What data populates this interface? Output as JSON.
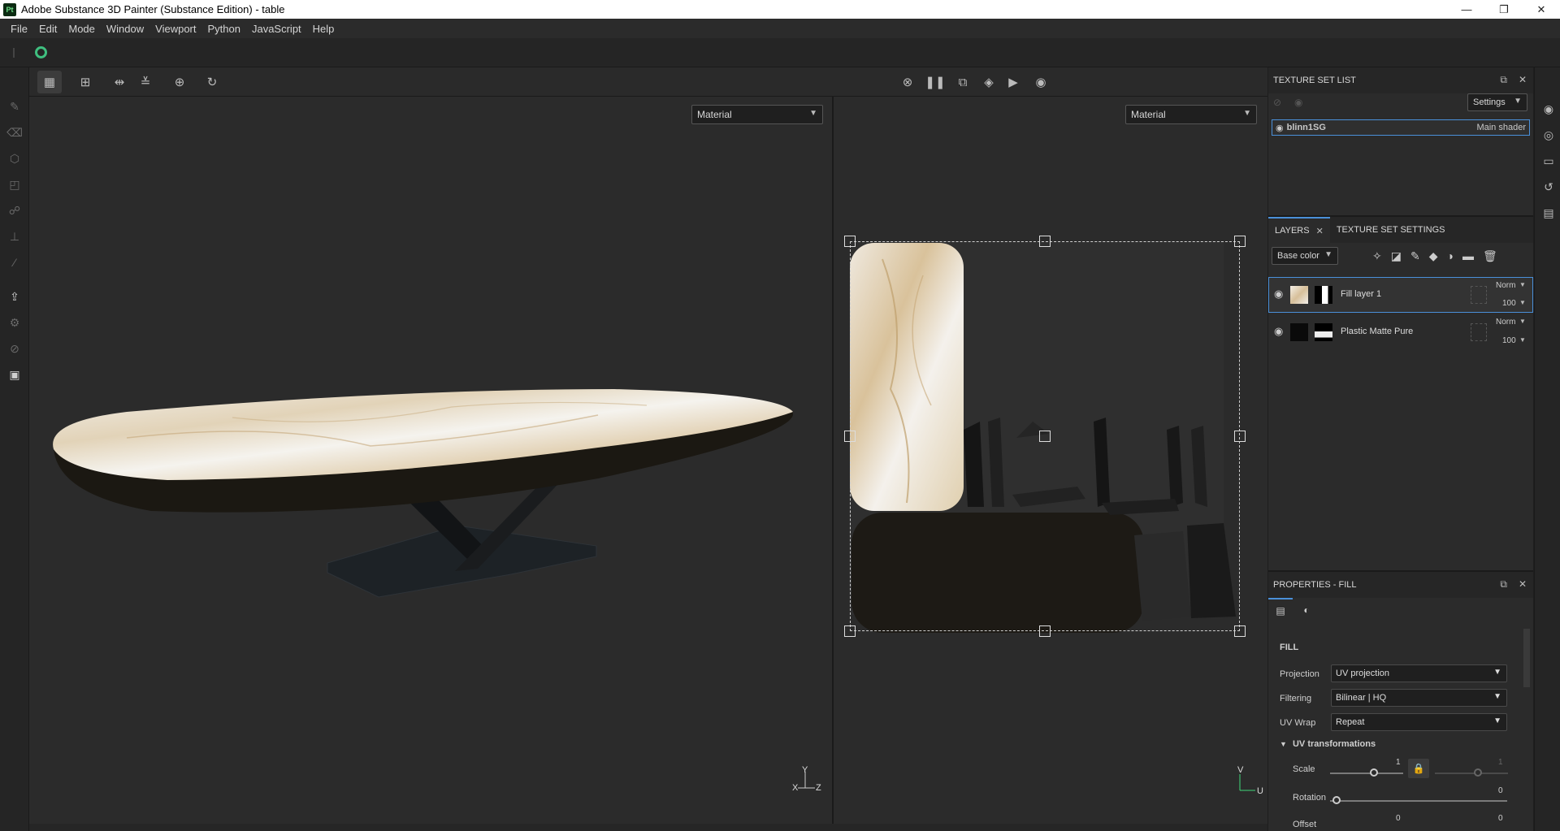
{
  "window": {
    "title": "Adobe Substance 3D Painter (Substance Edition) - table",
    "app_icon": "Pt",
    "buttons": {
      "minimize": "—",
      "restore": "❐",
      "close": "✕"
    }
  },
  "menu": [
    "File",
    "Edit",
    "Mode",
    "Window",
    "Viewport",
    "Python",
    "JavaScript",
    "Help"
  ],
  "viewport": {
    "left_mode": "Material",
    "right_mode": "Material",
    "axes_3d": {
      "y": "Y",
      "x": "X",
      "z": "Z"
    },
    "axes_2d": {
      "v": "V",
      "u": "U"
    }
  },
  "texture_set_list": {
    "header": "TEXTURE SET LIST",
    "settings_label": "Settings",
    "item_name": "blinn1SG",
    "item_shader": "Main shader"
  },
  "layers": {
    "tab_layers": "LAYERS",
    "tab_tss": "TEXTURE SET SETTINGS",
    "channel": "Base color",
    "rows": [
      {
        "name": "Fill layer 1",
        "blend": "Norm",
        "opacity": "100"
      },
      {
        "name": "Plastic Matte Pure",
        "blend": "Norm",
        "opacity": "100"
      }
    ]
  },
  "properties": {
    "header": "PROPERTIES - FILL",
    "section": "FILL",
    "projection_label": "Projection",
    "projection_value": "UV projection",
    "filtering_label": "Filtering",
    "filtering_value": "Bilinear | HQ",
    "uvwrap_label": "UV Wrap",
    "uvwrap_value": "Repeat",
    "uv_transform_label": "UV transformations",
    "scale_label": "Scale",
    "scale_value": "1",
    "scale_value2": "1",
    "rotation_label": "Rotation",
    "rotation_value": "0",
    "offset_label": "Offset",
    "offset_value_u": "0",
    "offset_value_v": "0"
  },
  "colors": {
    "accent": "#4a90d9",
    "status_ok": "#3fbf7f"
  }
}
